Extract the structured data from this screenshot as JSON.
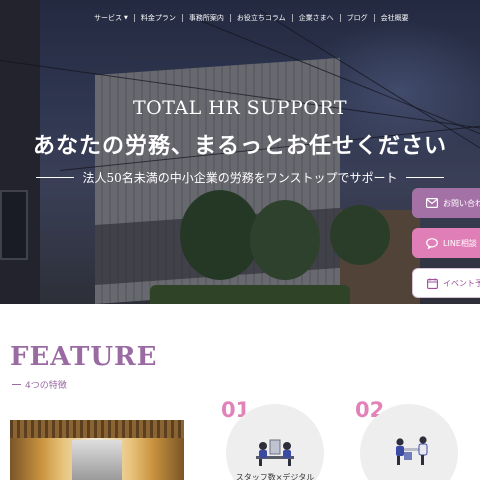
{
  "nav": {
    "items": [
      {
        "label": "サービス",
        "dropdown": true
      },
      {
        "label": "料金プラン"
      },
      {
        "label": "事務所案内"
      },
      {
        "label": "お役立ちコラム"
      },
      {
        "label": "企業さまへ"
      },
      {
        "label": "ブログ"
      },
      {
        "label": "会社概要"
      }
    ]
  },
  "hero": {
    "title": "TOTAL HR SUPPORT",
    "heading": "あなたの労務、まるっとお任せください",
    "subheading": "法人50名未満の中小企業の労務をワンストップでサポート"
  },
  "side_buttons": {
    "contact": "お問い合わせ",
    "line": "LINE相談",
    "event": "イベント予約"
  },
  "feature": {
    "title": "FEATURE",
    "subtitle": "4つの特徴",
    "items": [
      {
        "number": "01",
        "label": "スタッフ数×デジタル"
      },
      {
        "number": "02",
        "label": ""
      }
    ]
  },
  "colors": {
    "accent_purple": "#9a6aa3",
    "accent_pink": "#e183b8",
    "contact_button": "#a471a6",
    "line_button": "#e07fb7"
  }
}
